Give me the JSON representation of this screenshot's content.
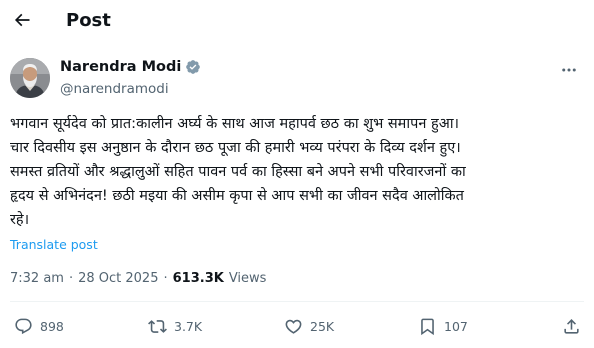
{
  "header": {
    "title": "Post",
    "back_icon": "arrow-left-icon"
  },
  "author": {
    "display_name": "Narendra Modi",
    "handle": "@narendramodi",
    "verified_icon": "verified-badge-icon",
    "verified_color": "#829aab",
    "more_icon": "more-horizontal-icon"
  },
  "post": {
    "text": "भगवान सूर्यदेव को प्रात:कालीन अर्घ्य के साथ आज महापर्व छठ का शुभ समापन हुआ।\nचार दिवसीय इस अनुष्ठान के दौरान छठ पूजा की हमारी भव्य परंपरा के दिव्य दर्शन हुए।\nसमस्त व्रतियों और श्रद्धालुओं सहित पावन पर्व का हिस्सा बने अपने सभी परिवारजनों का\nहृदय से अभिनंदन! छठी मइया की असीम कृपा से आप सभी का जीवन सदैव आलोकित\nरहे।",
    "translate_label": "Translate post",
    "link_color": "#1d9bf0"
  },
  "meta": {
    "time": "7:32 am",
    "separator": "·",
    "date": "28 Oct 2025",
    "separator2": "·",
    "views_count": "613.3K",
    "views_label": "Views"
  },
  "actions": {
    "replies": "898",
    "reposts": "3.7K",
    "likes": "25K",
    "views": "107"
  }
}
